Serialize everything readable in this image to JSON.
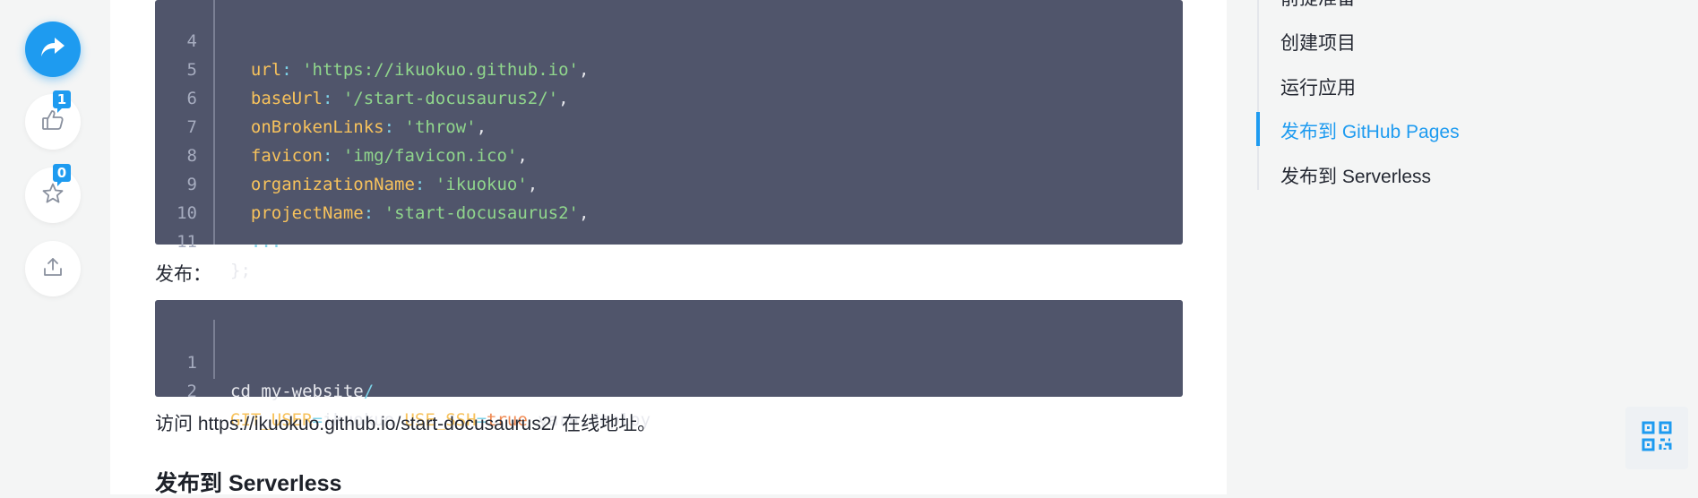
{
  "side_actions": {
    "like_count": "1",
    "collect_count": "0"
  },
  "code1": {
    "lines": [
      {
        "n": "4",
        "key": "url",
        "sep": ": ",
        "val": "'https://ikuokuo.github.io'",
        "end": ","
      },
      {
        "n": "5",
        "key": "baseUrl",
        "sep": ": ",
        "val": "'/start-docusaurus2/'",
        "end": ","
      },
      {
        "n": "6",
        "key": "onBrokenLinks",
        "sep": ": ",
        "val": "'throw'",
        "end": ","
      },
      {
        "n": "7",
        "key": "favicon",
        "sep": ": ",
        "val": "'img/favicon.ico'",
        "end": ","
      },
      {
        "n": "8",
        "key": "organizationName",
        "sep": ": ",
        "val": "'ikuokuo'",
        "end": ","
      },
      {
        "n": "9",
        "key": "projectName",
        "sep": ": ",
        "val": "'start-docusaurus2'",
        "end": ","
      },
      {
        "n": "10",
        "ellipsis": "..."
      },
      {
        "n": "11",
        "close": "};"
      }
    ]
  },
  "publish_label": "发布：",
  "code2": {
    "line1": {
      "n": "1",
      "cmd": "cd my-website",
      "slash": "/"
    },
    "line2": {
      "n": "2",
      "var1": "GIT_USER",
      "eq1": "=",
      "val1": "ikuokuo ",
      "var2": "USE_SSH",
      "eq2": "=",
      "val2": "true",
      "rest": " yarn deploy"
    }
  },
  "visit_text": "访问 https://ikuokuo.github.io/start-docusaurus2/ 在线地址。",
  "section_heading": "发布到 Serverless",
  "toc": {
    "items": [
      {
        "label": "前提准备",
        "active": false
      },
      {
        "label": "创建项目",
        "active": false
      },
      {
        "label": "运行应用",
        "active": false
      },
      {
        "label": "发布到 GitHub Pages",
        "active": true
      },
      {
        "label": "发布到 Serverless",
        "active": false
      }
    ]
  },
  "colors": {
    "accent": "#1e9bf0",
    "code_bg": "#50556b"
  },
  "icons": [
    "share-icon",
    "thumbs-up-icon",
    "star-icon",
    "upload-icon",
    "qr-code-icon"
  ]
}
